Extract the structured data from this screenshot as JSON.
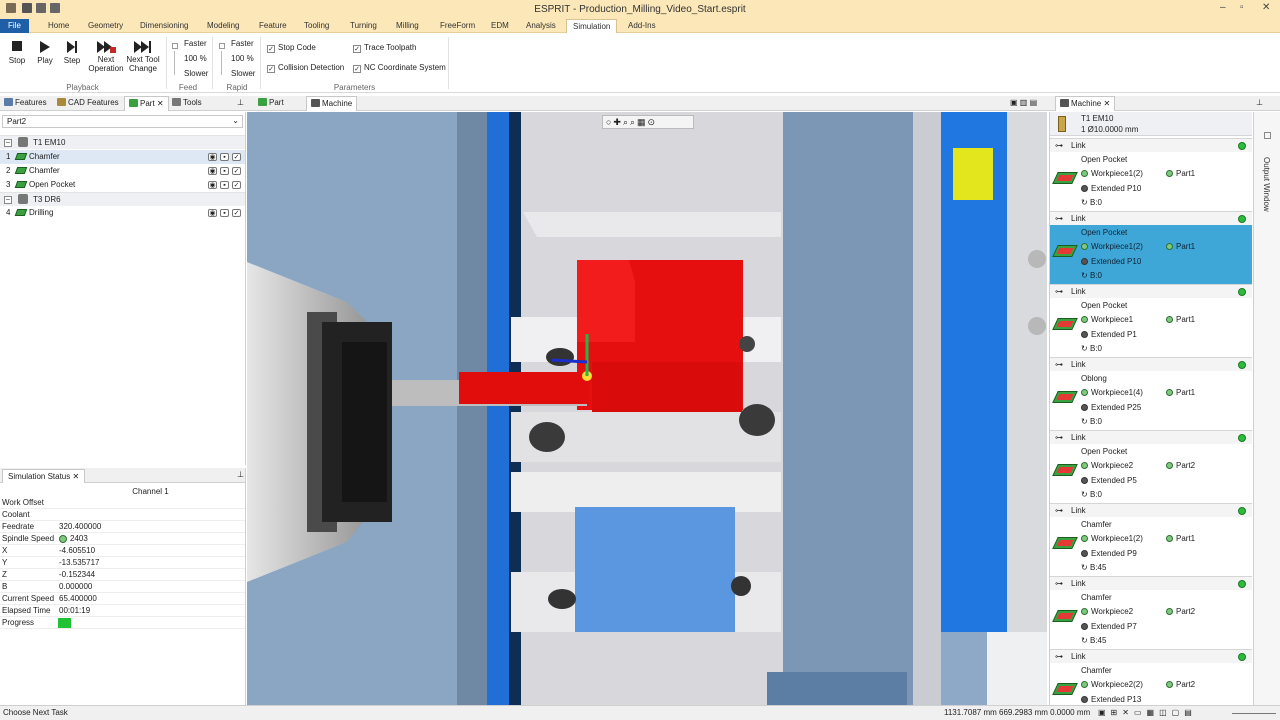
{
  "window": {
    "title": "ESPRIT - Production_Milling_Video_Start.esprit"
  },
  "menu": [
    "File",
    "Home",
    "Geometry",
    "Dimensioning",
    "Modeling",
    "Feature",
    "Tooling",
    "Turning",
    "Milling",
    "FreeForm",
    "EDM",
    "Analysis",
    "Simulation",
    "Add-Ins"
  ],
  "ribbon": {
    "stop": "Stop",
    "play": "Play",
    "step": "Step",
    "next_op_1": "Next",
    "next_op_2": "Operation",
    "next_tool_1": "Next Tool",
    "next_tool_2": "Change",
    "playback": "Playback",
    "feed_faster": "Faster",
    "feed_pct": "100 %",
    "feed_slower": "Slower",
    "feed": "Feed",
    "rapid_faster": "Faster",
    "rapid_pct": "100 %",
    "rapid_slower": "Slower",
    "rapid": "Rapid",
    "stop_code": "Stop Code",
    "collision": "Collision Detection",
    "trace": "Trace Toolpath",
    "nc_coord": "NC Coordinate System",
    "parameters": "Parameters"
  },
  "tabs": {
    "features": "Features",
    "cad_features": "CAD Features",
    "part": "Part",
    "tools": "Tools",
    "view_part": "Part",
    "view_machine": "Machine",
    "machine": "Machine"
  },
  "left": {
    "dropdown": "Part2",
    "tool1": "T1  EM10",
    "ops1": [
      {
        "n": "1",
        "name": "Chamfer"
      },
      {
        "n": "2",
        "name": "Chamfer"
      },
      {
        "n": "3",
        "name": "Open Pocket"
      }
    ],
    "tool2": "T3  DR6",
    "ops2": [
      {
        "n": "4",
        "name": "Drilling"
      }
    ]
  },
  "sim": {
    "title": "Simulation Status",
    "channel": "Channel 1",
    "rows": [
      {
        "k": "Work Offset",
        "v": ""
      },
      {
        "k": "Coolant",
        "v": ""
      },
      {
        "k": "Feedrate",
        "v": "320.400000"
      },
      {
        "k": "Spindle Speed",
        "v": "2403"
      },
      {
        "k": "X",
        "v": "-4.605510"
      },
      {
        "k": "Y",
        "v": "-13.535717"
      },
      {
        "k": "Z",
        "v": "-0.152344"
      },
      {
        "k": "B",
        "v": "0.000000"
      },
      {
        "k": "Current Speed",
        "v": "65.400000"
      },
      {
        "k": "Elapsed Time",
        "v": "00:01:19"
      },
      {
        "k": "Progress",
        "v": ""
      }
    ]
  },
  "right": {
    "tool_name": "T1  EM10",
    "tool_dia": "1   Ø10.0000 mm",
    "link": "Link",
    "ops": [
      {
        "name": "Open Pocket",
        "wp": "Workpiece1(2)",
        "part": "Part1",
        "ext": "Extended P10",
        "b": "B:0"
      },
      {
        "name": "Open Pocket",
        "wp": "Workpiece1(2)",
        "part": "Part1",
        "ext": "Extended P10",
        "b": "B:0"
      },
      {
        "name": "Open Pocket",
        "wp": "Workpiece1",
        "part": "Part1",
        "ext": "Extended P1",
        "b": "B:0"
      },
      {
        "name": "Oblong",
        "wp": "Workpiece1(4)",
        "part": "Part1",
        "ext": "Extended P25",
        "b": "B:0"
      },
      {
        "name": "Open Pocket",
        "wp": "Workpiece2",
        "part": "Part2",
        "ext": "Extended P5",
        "b": "B:0"
      },
      {
        "name": "Chamfer",
        "wp": "Workpiece1(2)",
        "part": "Part1",
        "ext": "Extended P9",
        "b": "B:45"
      },
      {
        "name": "Chamfer",
        "wp": "Workpiece2",
        "part": "Part2",
        "ext": "Extended P7",
        "b": "B:45"
      },
      {
        "name": "Chamfer",
        "wp": "Workpiece2(2)",
        "part": "Part2",
        "ext": "Extended P13",
        "b": ""
      }
    ],
    "output_window": "Output Window"
  },
  "status": {
    "left": "Choose Next Task",
    "coords": "1131.7087 mm  669.2983 mm  0.0000 mm"
  }
}
